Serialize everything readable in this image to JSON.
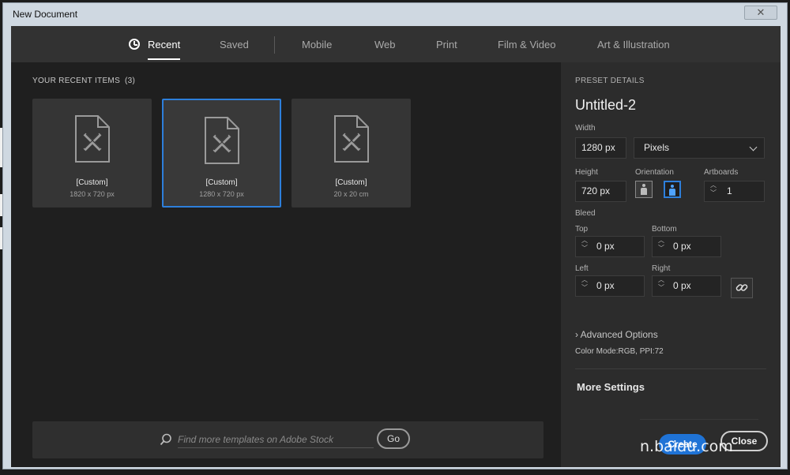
{
  "window": {
    "title": "New Document",
    "close_glyph": "✕"
  },
  "nav": {
    "tabs": [
      {
        "label": "Recent",
        "active": true
      },
      {
        "label": "Saved"
      },
      {
        "label": "Mobile"
      },
      {
        "label": "Web"
      },
      {
        "label": "Print"
      },
      {
        "label": "Film & Video"
      },
      {
        "label": "Art & Illustration"
      }
    ]
  },
  "recent": {
    "header": "YOUR RECENT ITEMS",
    "count": "(3)",
    "items": [
      {
        "name": "[Custom]",
        "size": "1820 x 720 px"
      },
      {
        "name": "[Custom]",
        "size": "1280 x 720 px",
        "selected": true
      },
      {
        "name": "[Custom]",
        "size": "20 x 20 cm"
      }
    ]
  },
  "search": {
    "placeholder": "Find more templates on Adobe Stock",
    "go_label": "Go"
  },
  "preset": {
    "header": "PRESET DETAILS",
    "name": "Untitled-2",
    "width_label": "Width",
    "width_value": "1280 px",
    "units_value": "Pixels",
    "height_label": "Height",
    "height_value": "720 px",
    "orientation_label": "Orientation",
    "artboards_label": "Artboards",
    "artboards_value": "1",
    "bleed_label": "Bleed",
    "top_label": "Top",
    "top_value": "0 px",
    "bottom_label": "Bottom",
    "bottom_value": "0 px",
    "left_label": "Left",
    "left_value": "0 px",
    "right_label": "Right",
    "right_value": "0 px",
    "advanced_label": "Advanced Options",
    "color_mode": "Color Mode:RGB, PPI:72",
    "more_settings": "More Settings"
  },
  "actions": {
    "create": "Create",
    "close": "Close"
  },
  "watermark": "n.baidu.com",
  "colors": {
    "accent": "#2d7fdb",
    "create_bg": "#1f73d6"
  }
}
